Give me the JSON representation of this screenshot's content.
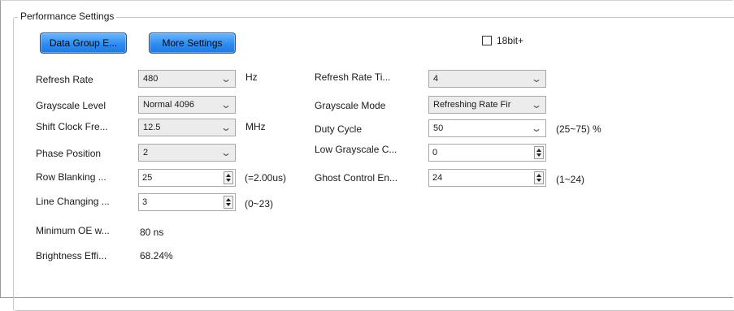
{
  "group_title": "Performance Settings",
  "buttons": {
    "data_group": "Data Group E...",
    "more_settings": "More Settings"
  },
  "checkbox_18bit": {
    "label": "18bit+",
    "checked": false
  },
  "left": {
    "refresh_rate": {
      "label": "Refresh Rate",
      "value": "480",
      "unit": "Hz"
    },
    "grayscale_level": {
      "label": "Grayscale Level",
      "value": "Normal 4096"
    },
    "shift_clock": {
      "label": "Shift Clock Fre...",
      "value": "12.5",
      "unit": "MHz"
    },
    "phase_position": {
      "label": "Phase Position",
      "value": "2"
    },
    "row_blanking": {
      "label": "Row Blanking ...",
      "value": "25",
      "note": "(=2.00us)"
    },
    "line_changing": {
      "label": "Line Changing ...",
      "value": "3",
      "note": "(0~23)"
    },
    "minimum_oe": {
      "label": "Minimum OE w...",
      "value": "80 ns"
    },
    "brightness_eff": {
      "label": "Brightness Effi...",
      "value": "68.24%"
    }
  },
  "right": {
    "refresh_rate_times": {
      "label": "Refresh Rate Ti...",
      "value": "4"
    },
    "grayscale_mode": {
      "label": "Grayscale Mode",
      "value": "Refreshing Rate Fir"
    },
    "duty_cycle": {
      "label": "Duty Cycle",
      "value": "50",
      "note": "(25~75) %"
    },
    "low_grayscale": {
      "label": "Low Grayscale C...",
      "value": "0"
    },
    "ghost_control": {
      "label": "Ghost Control En...",
      "value": "24",
      "note": "(1~24)"
    }
  }
}
